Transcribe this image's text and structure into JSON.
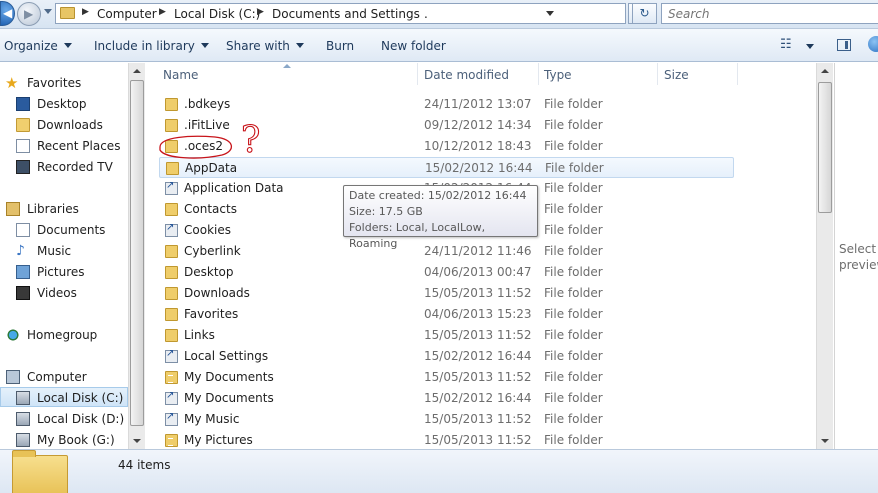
{
  "address": {
    "crumbs": [
      "Computer",
      "Local Disk (C:)",
      "Documents and Settings"
    ],
    "trailing": ".",
    "refresh_icon": "refresh-icon"
  },
  "search": {
    "placeholder": "Search"
  },
  "toolbar": {
    "organize": "Organize",
    "include": "Include in library",
    "share": "Share with",
    "burn": "Burn",
    "new_folder": "New folder"
  },
  "nav": {
    "favorites": "Favorites",
    "desktop": "Desktop",
    "downloads": "Downloads",
    "recent": "Recent Places",
    "recorded": "Recorded TV",
    "libraries": "Libraries",
    "documents": "Documents",
    "music": "Music",
    "pictures": "Pictures",
    "videos": "Videos",
    "homegroup": "Homegroup",
    "computer": "Computer",
    "disk_c": "Local Disk (C:)",
    "disk_d": "Local Disk (D:)",
    "mybook": "My Book (G:)"
  },
  "columns": {
    "name": "Name",
    "date": "Date modified",
    "type": "Type",
    "size": "Size"
  },
  "files": [
    {
      "name": ".bdkeys",
      "date": "24/11/2012 13:07",
      "type": "File folder",
      "icon": "folder"
    },
    {
      "name": ".iFitLive",
      "date": "09/12/2012 14:34",
      "type": "File folder",
      "icon": "folder"
    },
    {
      "name": ".oces2",
      "date": "10/12/2012 18:43",
      "type": "File folder",
      "icon": "folder"
    },
    {
      "name": "AppData",
      "date": "15/02/2012 16:44",
      "type": "File folder",
      "icon": "folder"
    },
    {
      "name": "Application Data",
      "date": "15/02/2012 16:44",
      "type": "File folder",
      "icon": "shortcut"
    },
    {
      "name": "Contacts",
      "date": "",
      "type": "File folder",
      "icon": "folder"
    },
    {
      "name": "Cookies",
      "date": "",
      "type": "File folder",
      "icon": "shortcut"
    },
    {
      "name": "Cyberlink",
      "date": "24/11/2012 11:46",
      "type": "File folder",
      "icon": "folder"
    },
    {
      "name": "Desktop",
      "date": "04/06/2013 00:47",
      "type": "File folder",
      "icon": "folder"
    },
    {
      "name": "Downloads",
      "date": "15/05/2013 11:52",
      "type": "File folder",
      "icon": "folder"
    },
    {
      "name": "Favorites",
      "date": "04/06/2013 15:23",
      "type": "File folder",
      "icon": "folder"
    },
    {
      "name": "Links",
      "date": "15/05/2013 11:52",
      "type": "File folder",
      "icon": "folder"
    },
    {
      "name": "Local Settings",
      "date": "15/02/2012 16:44",
      "type": "File folder",
      "icon": "shortcut"
    },
    {
      "name": "My Documents",
      "date": "15/05/2013 11:52",
      "type": "File folder",
      "icon": "folder-lines"
    },
    {
      "name": "My Documents",
      "date": "15/02/2012 16:44",
      "type": "File folder",
      "icon": "shortcut"
    },
    {
      "name": "My Music",
      "date": "15/05/2013 11:52",
      "type": "File folder",
      "icon": "shortcut"
    },
    {
      "name": "My Pictures",
      "date": "15/05/2013 11:52",
      "type": "File folder",
      "icon": "folder-lines"
    }
  ],
  "tooltip": {
    "created": "Date created: 15/02/2012 16:44",
    "size": "Size: 17.5 GB",
    "folders": "Folders: Local, LocalLow, Roaming"
  },
  "preview": {
    "text": "Select a file to preview."
  },
  "annotation": {
    "mark": "?"
  },
  "status": {
    "count": "44 items"
  }
}
